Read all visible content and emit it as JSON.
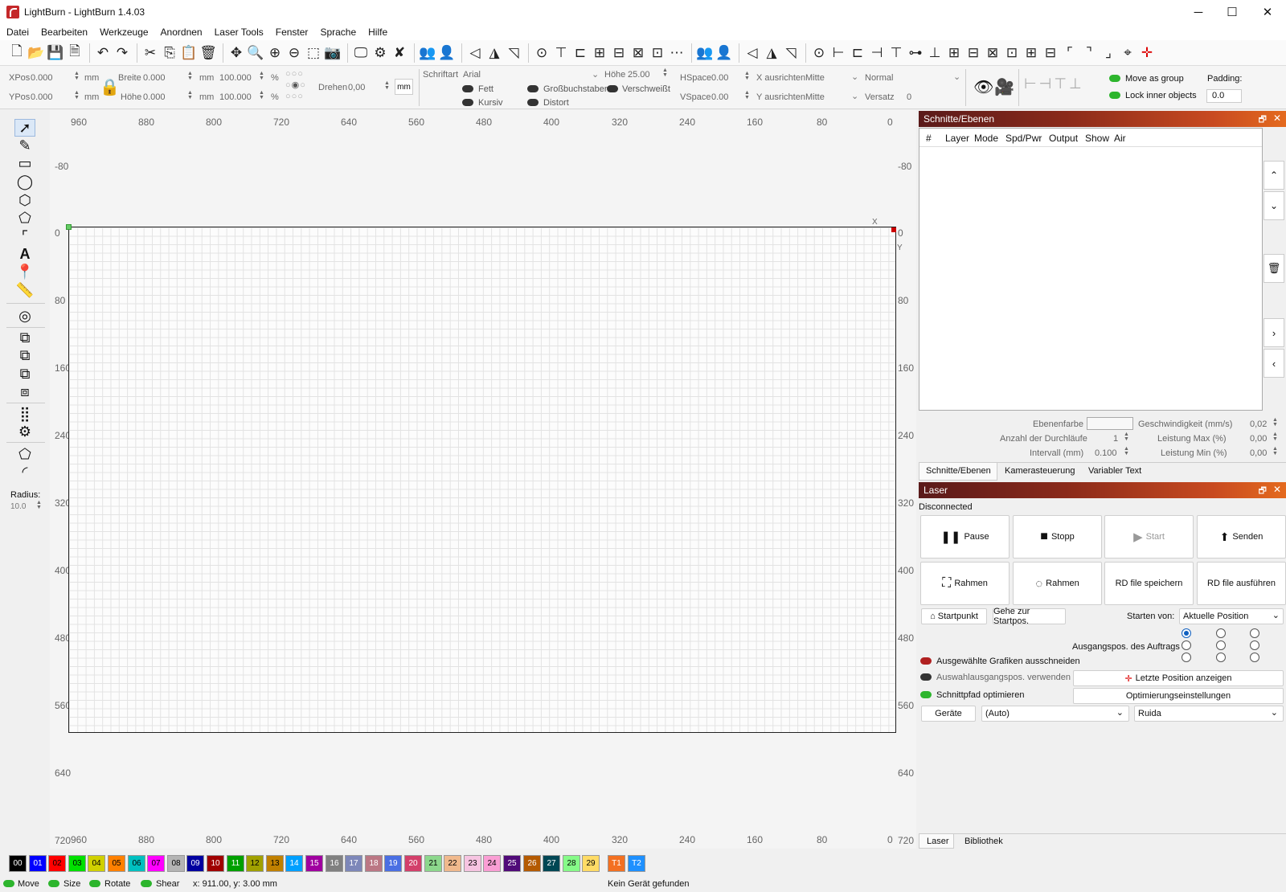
{
  "window": {
    "title": "LightBurn - LightBurn 1.4.03",
    "minimize": "─",
    "maximize": "☐",
    "close": "✕"
  },
  "menu": [
    "Datei",
    "Bearbeiten",
    "Werkzeuge",
    "Anordnen",
    "Laser Tools",
    "Fenster",
    "Sprache",
    "Hilfe"
  ],
  "props": {
    "xpos_label": "XPos",
    "xpos": "0.000",
    "ypos_label": "YPos",
    "ypos": "0.000",
    "unit_mm": "mm",
    "breite_label": "Breite",
    "breite": "0.000",
    "hoehe_label": "Höhe",
    "hoehe": "0.000",
    "scale_w": "100.000",
    "scale_h": "100.000",
    "pct": "%",
    "drehen_label": "Drehen",
    "drehen": "0,00",
    "mm_btn": "mm"
  },
  "text": {
    "schriftart_label": "Schriftart",
    "schriftart": "Arial",
    "hoehe_label": "Höhe",
    "hoehe": "25.00",
    "hspace_label": "HSpace",
    "hspace": "0.00",
    "vspace_label": "VSpace",
    "vspace": "0.00",
    "xalign_label": "X ausrichten",
    "xalign": "Mitte",
    "yalign_label": "Y ausrichten",
    "yalign": "Mitte",
    "style": "Normal",
    "versatz_label": "Versatz",
    "versatz": "0",
    "fett": "Fett",
    "kursiv": "Kursiv",
    "gross": "Großbuchstaben",
    "distort": "Distort",
    "verschweisst": "Verschweißt"
  },
  "group": {
    "move_as_group": "Move as group",
    "lock_inner": "Lock inner objects",
    "padding_label": "Padding:",
    "padding": "0.0"
  },
  "ruler": {
    "top": [
      "960",
      "880",
      "800",
      "720",
      "640",
      "560",
      "480",
      "400",
      "320",
      "240",
      "160",
      "80",
      "0"
    ],
    "left": [
      "-80",
      "0",
      "80",
      "160",
      "240",
      "320",
      "400",
      "480",
      "560",
      "640",
      "720"
    ],
    "right": [
      "-80",
      "0",
      "80",
      "160",
      "240",
      "320",
      "400",
      "480",
      "560",
      "640",
      "720"
    ],
    "x_marker": "X",
    "y_marker": "Y"
  },
  "left_tools": {
    "radius_label": "Radius:",
    "radius": "10.0"
  },
  "cuts": {
    "title": "Schnitte/Ebenen",
    "columns": [
      "#",
      "Layer",
      "Mode",
      "Spd/Pwr",
      "Output",
      "Show",
      "Air"
    ],
    "ebenenfarbe": "Ebenenfarbe",
    "geschw_label": "Geschwindigkeit (mm/s)",
    "geschw": "0,02",
    "durchlaeufe_label": "Anzahl der Durchläufe",
    "durchlaeufe": "1",
    "leistmax_label": "Leistung Max (%)",
    "leistmax": "0,00",
    "intervall_label": "Intervall (mm)",
    "intervall": "0.100",
    "leistmin_label": "Leistung Min (%)",
    "leistmin": "0,00",
    "tabs": [
      "Schnitte/Ebenen",
      "Kamerasteuerung",
      "Variabler Text"
    ]
  },
  "laser": {
    "title": "Laser",
    "status": "Disconnected",
    "pause": "Pause",
    "stopp": "Stopp",
    "start": "Start",
    "senden": "Senden",
    "rahmen1": "Rahmen",
    "rahmen2": "Rahmen",
    "rd_save": "RD file speichern",
    "rd_run": "RD file ausführen",
    "startpunkt": "Startpunkt",
    "gehe": "Gehe zur Startpos.",
    "starten_von_label": "Starten von:",
    "starten_von": "Aktuelle Position",
    "ausgangspos_label": "Ausgangspos. des Auftrags",
    "cut_selected": "Ausgewählte Grafiken ausschneiden",
    "use_selection_origin": "Auswahlausgangspos. verwenden",
    "optimize": "Schnittpfad optimieren",
    "last_pos": "Letzte Position anzeigen",
    "opt_settings": "Optimierungseinstellungen",
    "geraete": "Geräte",
    "auto": "(Auto)",
    "device": "Ruida",
    "tabs": [
      "Laser",
      "Bibliothek"
    ]
  },
  "palette": [
    {
      "label": "00",
      "color": "#000000",
      "fg": "#ffffff"
    },
    {
      "label": "01",
      "color": "#0000ff",
      "fg": "#ffffff"
    },
    {
      "label": "02",
      "color": "#ff0000",
      "fg": "#000000"
    },
    {
      "label": "03",
      "color": "#00e000",
      "fg": "#000000"
    },
    {
      "label": "04",
      "color": "#d0d000",
      "fg": "#000000"
    },
    {
      "label": "05",
      "color": "#ff8000",
      "fg": "#000000"
    },
    {
      "label": "06",
      "color": "#00c0c0",
      "fg": "#000000"
    },
    {
      "label": "07",
      "color": "#ff00ff",
      "fg": "#000000"
    },
    {
      "label": "08",
      "color": "#b4b4b4",
      "fg": "#000000"
    },
    {
      "label": "09",
      "color": "#0000a0",
      "fg": "#ffffff"
    },
    {
      "label": "10",
      "color": "#a00000",
      "fg": "#ffffff"
    },
    {
      "label": "11",
      "color": "#00a000",
      "fg": "#ffffff"
    },
    {
      "label": "12",
      "color": "#a0a000",
      "fg": "#000000"
    },
    {
      "label": "13",
      "color": "#c08000",
      "fg": "#000000"
    },
    {
      "label": "14",
      "color": "#00a0ff",
      "fg": "#ffffff"
    },
    {
      "label": "15",
      "color": "#a000a0",
      "fg": "#ffffff"
    },
    {
      "label": "16",
      "color": "#808080",
      "fg": "#ffffff"
    },
    {
      "label": "17",
      "color": "#7d87b9",
      "fg": "#ffffff"
    },
    {
      "label": "18",
      "color": "#bb7784",
      "fg": "#ffffff"
    },
    {
      "label": "19",
      "color": "#4a6fe3",
      "fg": "#ffffff"
    },
    {
      "label": "20",
      "color": "#d33f6a",
      "fg": "#ffffff"
    },
    {
      "label": "21",
      "color": "#8cd78c",
      "fg": "#000000"
    },
    {
      "label": "22",
      "color": "#f0b98d",
      "fg": "#000000"
    },
    {
      "label": "23",
      "color": "#f6c4e1",
      "fg": "#000000"
    },
    {
      "label": "24",
      "color": "#fa9ed4",
      "fg": "#000000"
    },
    {
      "label": "25",
      "color": "#500a78",
      "fg": "#ffffff"
    },
    {
      "label": "26",
      "color": "#b45a00",
      "fg": "#ffffff"
    },
    {
      "label": "27",
      "color": "#004754",
      "fg": "#ffffff"
    },
    {
      "label": "28",
      "color": "#86fa88",
      "fg": "#000000"
    },
    {
      "label": "29",
      "color": "#ffdb66",
      "fg": "#000000"
    },
    {
      "label": "T1",
      "color": "#f37021",
      "fg": "#ffffff"
    },
    {
      "label": "T2",
      "color": "#1e90ff",
      "fg": "#ffffff"
    }
  ],
  "status": {
    "move": "Move",
    "size": "Size",
    "rotate": "Rotate",
    "shear": "Shear",
    "coords": "x: 911.00, y: 3.00 mm",
    "device": "Kein Gerät gefunden"
  }
}
